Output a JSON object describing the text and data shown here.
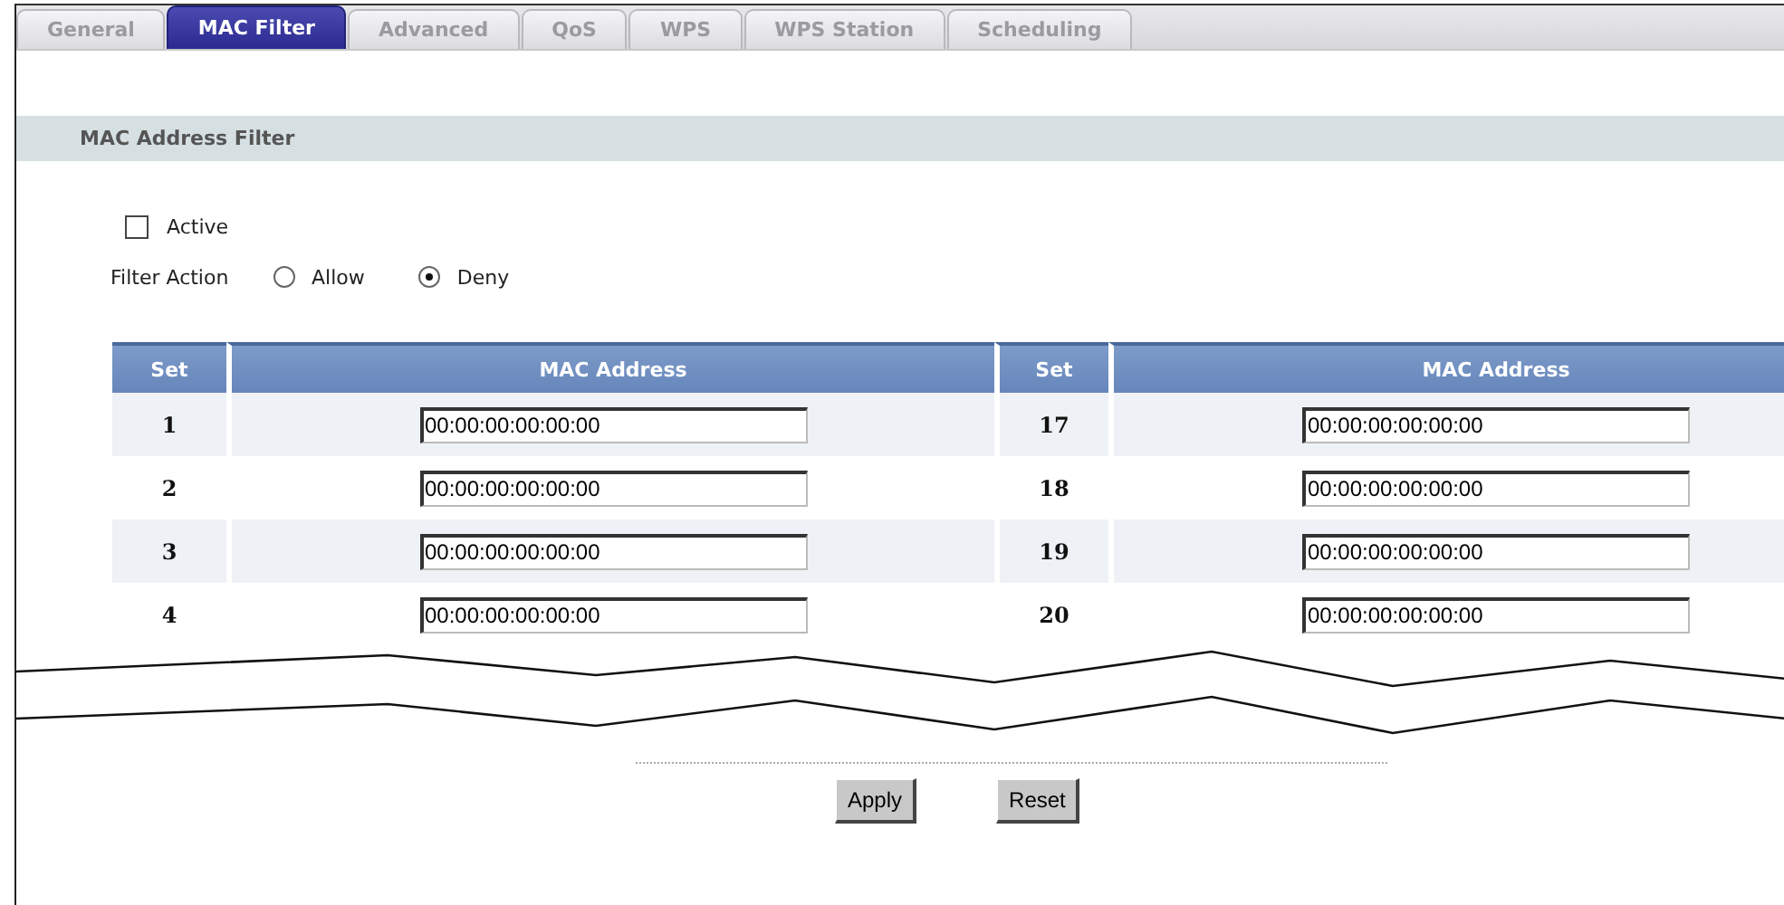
{
  "tabs": [
    {
      "label": "General",
      "selected": false
    },
    {
      "label": "MAC Filter",
      "selected": true
    },
    {
      "label": "Advanced",
      "selected": false
    },
    {
      "label": "QoS",
      "selected": false
    },
    {
      "label": "WPS",
      "selected": false
    },
    {
      "label": "WPS Station",
      "selected": false
    },
    {
      "label": "Scheduling",
      "selected": false
    }
  ],
  "section_title": "MAC Address Filter",
  "active": {
    "label": "Active",
    "checked": false
  },
  "filter_action": {
    "label": "Filter Action",
    "options": [
      {
        "label": "Allow",
        "selected": false
      },
      {
        "label": "Deny",
        "selected": true
      }
    ]
  },
  "table": {
    "columns": [
      "Set",
      "MAC Address",
      "Set",
      "MAC Address"
    ],
    "rows": [
      {
        "left": {
          "set": "1",
          "mac": "00:00:00:00:00:00"
        },
        "right": {
          "set": "17",
          "mac": "00:00:00:00:00:00"
        }
      },
      {
        "left": {
          "set": "2",
          "mac": "00:00:00:00:00:00"
        },
        "right": {
          "set": "18",
          "mac": "00:00:00:00:00:00"
        }
      },
      {
        "left": {
          "set": "3",
          "mac": "00:00:00:00:00:00"
        },
        "right": {
          "set": "19",
          "mac": "00:00:00:00:00:00"
        }
      },
      {
        "left": {
          "set": "4",
          "mac": "00:00:00:00:00:00"
        },
        "right": {
          "set": "20",
          "mac": "00:00:00:00:00:00"
        }
      }
    ]
  },
  "buttons": [
    "Apply",
    "Reset"
  ]
}
